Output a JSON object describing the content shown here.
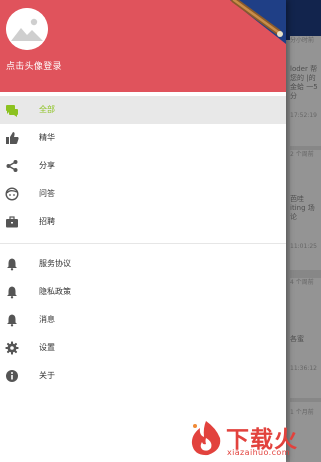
{
  "drawer": {
    "login_label": "点击头像登录",
    "menu_primary": [
      {
        "label": "全部",
        "icon": "forum-icon",
        "active": true
      },
      {
        "label": "精华",
        "icon": "thumb-up-icon",
        "active": false
      },
      {
        "label": "分享",
        "icon": "share-icon",
        "active": false
      },
      {
        "label": "问答",
        "icon": "face-icon",
        "active": false
      },
      {
        "label": "招聘",
        "icon": "briefcase-icon",
        "active": false
      }
    ],
    "menu_secondary": [
      {
        "label": "服务协议",
        "icon": "bell-icon"
      },
      {
        "label": "隐私政策",
        "icon": "bell-icon"
      },
      {
        "label": "消息",
        "icon": "bell-icon"
      },
      {
        "label": "设置",
        "icon": "gear-icon"
      },
      {
        "label": "关于",
        "icon": "info-icon"
      }
    ]
  },
  "background": {
    "cards": [
      {
        "time_top": "分小时前",
        "text": "loder 帮您的 |的金蛤 一5 分",
        "time_bottom": "17:52:19"
      },
      {
        "time_top": "2 个周前",
        "text": "芭哇 iting 场论",
        "time_bottom": "11:01:25"
      },
      {
        "time_top": "4 个周前",
        "text": "各蜜",
        "time_bottom": "11:36:12"
      },
      {
        "time_top": "1 个月前",
        "text": "",
        "time_bottom": ""
      }
    ]
  },
  "watermark": {
    "title": "下载火",
    "url": "xiazaihuo.com"
  },
  "colors": {
    "header": "#e0535c",
    "active_label": "#8cc21f",
    "icon": "#555555",
    "active_icon": "#8cc21f"
  }
}
